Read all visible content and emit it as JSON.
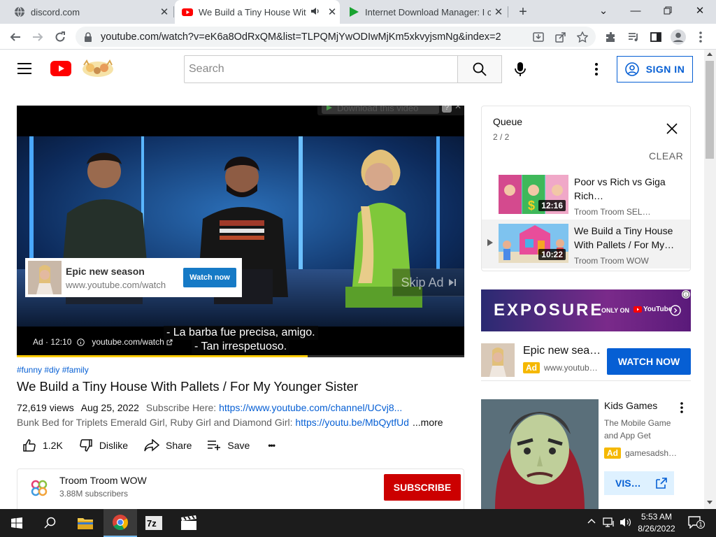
{
  "browser": {
    "tabs": [
      {
        "title": "discord.com"
      },
      {
        "title": "We Build a Tiny House With"
      },
      {
        "title": "Internet Download Manager: I ca"
      }
    ],
    "url": "youtube.com/watch?v=eK6a8OdRxQM&list=TLPQMjYwODIwMjKm5xkvyjsmNg&index=2"
  },
  "youtube": {
    "search_placeholder": "Search",
    "sign_in_label": "SIGN IN"
  },
  "player": {
    "download_label": "Download this video",
    "download_help": "?",
    "ad_overlay": {
      "title": "Epic new season",
      "url": "www.youtube.com/watch",
      "button": "Watch now"
    },
    "skip_ad_label": "Skip Ad",
    "subtitle_line1": "- La barba fue precisa, amigo.",
    "subtitle_line2": "- Tan irrespetuoso.",
    "ad_info": "Ad · 12:10",
    "ad_url": "youtube.com/watch",
    "progress_fraction": 0.65
  },
  "video": {
    "hashtags": "#funny #diy #family",
    "title": "We Build a Tiny House With Pallets / For My Younger Sister",
    "views": "72,619 views",
    "date": "Aug 25, 2022",
    "subscribe_text": "Subscribe Here: ",
    "subscribe_link": "https://www.youtube.com/channel/UCvj8...",
    "desc_text": "Bunk Bed for Triplets Emerald Girl, Ruby Girl and Diamond Girl: ",
    "desc_link": "https://youtu.be/MbQytfUd-",
    "more_label": "...more",
    "like_count": "1.2K",
    "dislike_label": "Dislike",
    "share_label": "Share",
    "save_label": "Save",
    "more_actions": "•••"
  },
  "channel": {
    "name": "Troom Troom WOW",
    "subscribers": "3.88M subscribers",
    "subscribe_label": "SUBSCRIBE"
  },
  "queue": {
    "title": "Queue",
    "position": "2 / 2",
    "clear_label": "CLEAR",
    "items": [
      {
        "title": "Poor vs Rich vs Giga Rich…",
        "channel": "Troom Troom SEL…",
        "duration": "12:16"
      },
      {
        "title": "We Build a Tiny House With Pallets / For My…",
        "channel": "Troom Troom WOW",
        "duration": "10:22"
      }
    ]
  },
  "banner": {
    "brand": "EXPOSURE",
    "only_on": "ONLY ON",
    "yt": "YouTube"
  },
  "sidebar_ad": {
    "title": "Epic new sea…",
    "badge": "Ad",
    "url": "www.youtub…",
    "button": "WATCH NOW"
  },
  "game_ad": {
    "title": "Kids Games",
    "desc": "The Mobile Game and App Get",
    "badge": "Ad",
    "domain": "gamesadsh…",
    "button": "VIS…"
  },
  "taskbar": {
    "time": "5:53 AM",
    "date": "8/26/2022",
    "notification_count": "1"
  },
  "colors": {
    "youtube_red": "#ff0000",
    "link_blue": "#065fd4",
    "subscribe_red": "#cc0000",
    "ad_yellow": "#f5b800"
  }
}
